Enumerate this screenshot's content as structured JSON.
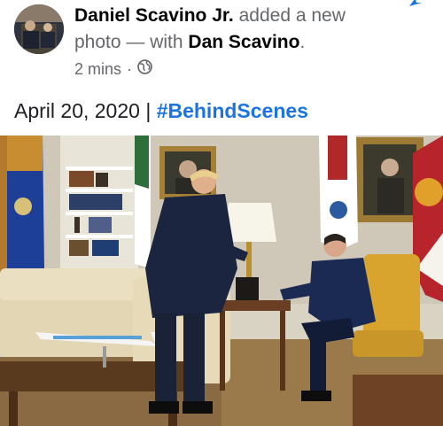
{
  "post": {
    "author": "Daniel Scavino Jr.",
    "action_text": "added a new",
    "action_text2": "photo — with",
    "tagged": "Dan Scavino",
    "tagged_suffix": ".",
    "time": "2 mins",
    "separator": "·",
    "privacy_icon": "globe-icon",
    "caption_date": "April 20, 2020 |",
    "caption_hashtag": "#BehindScenes"
  },
  "colors": {
    "hashtag": "#1b74e4",
    "muted": "#65676b"
  }
}
